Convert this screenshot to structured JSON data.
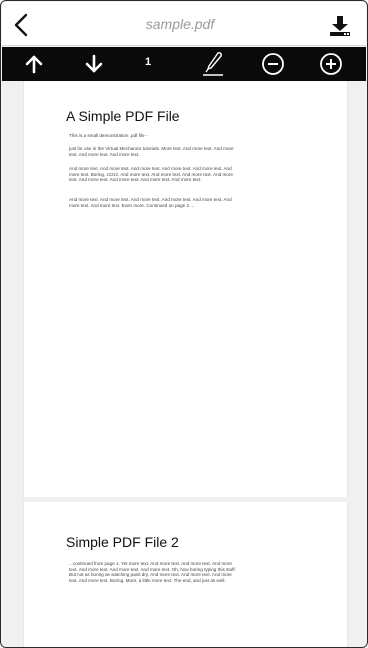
{
  "titlebar": {
    "title": "sample.pdf",
    "back_icon": "chevron-left-icon",
    "download_icon": "download-icon"
  },
  "toolbar": {
    "page_number": "1",
    "buttons": [
      "arrow-up-icon",
      "arrow-down-icon",
      "pen-icon",
      "zoom-out-icon",
      "zoom-in-icon"
    ]
  },
  "document": {
    "page1": {
      "heading": "A Simple PDF File",
      "paragraphs": [
        "This is a small demonstration .pdf file -",
        "just for use in the Virtual Mechanics tutorials. More text. And more text. And more text. And more text. And more text.",
        "And more text. And more text. And more text. And more text. And more text. And more text. Boring, zzzzz. And more text. And more text. And more text. And more text. And more text. And more text. And more text. And more text.",
        "And more text. And more text. And more text. And more text. And more text. And more text. And more text. Even more. Continued on page 2 ..."
      ]
    },
    "page2": {
      "heading": "Simple PDF File 2",
      "paragraphs": [
        "...continued from page 1. Yet more text. And more text. And more text. And more text. And more text. And more text. And more text. Oh, how boring typing this stuff. But not as boring as watching paint dry. And more text. And more text. And more text. And more text. Boring. More, a little more text. The end, and just as well."
      ]
    }
  },
  "colors": {
    "toolbar_bg": "#0a0a0a",
    "title_text": "#9a9a9a"
  }
}
